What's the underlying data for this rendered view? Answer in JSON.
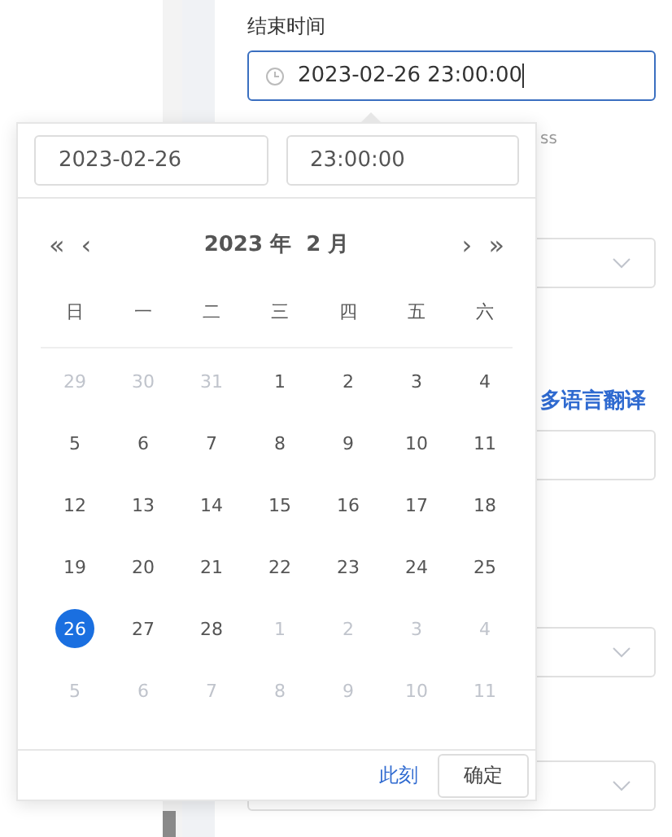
{
  "form": {
    "label": "结束时间",
    "value": "2023-02-26 23:00:00",
    "hint_fragment": "ss",
    "link": "多语言翻译"
  },
  "picker": {
    "date_input": "2023-02-26",
    "time_input": "23:00:00",
    "nav": {
      "prev_year": "«",
      "prev_month": "‹",
      "title": "2023 年  2 月",
      "next_month": "›",
      "next_year": "»"
    },
    "weekdays": [
      "日",
      "一",
      "二",
      "三",
      "四",
      "五",
      "六"
    ],
    "days": [
      {
        "label": "29",
        "muted": true,
        "selected": false
      },
      {
        "label": "30",
        "muted": true,
        "selected": false
      },
      {
        "label": "31",
        "muted": true,
        "selected": false
      },
      {
        "label": "1",
        "muted": false,
        "selected": false
      },
      {
        "label": "2",
        "muted": false,
        "selected": false
      },
      {
        "label": "3",
        "muted": false,
        "selected": false
      },
      {
        "label": "4",
        "muted": false,
        "selected": false
      },
      {
        "label": "5",
        "muted": false,
        "selected": false
      },
      {
        "label": "6",
        "muted": false,
        "selected": false
      },
      {
        "label": "7",
        "muted": false,
        "selected": false
      },
      {
        "label": "8",
        "muted": false,
        "selected": false
      },
      {
        "label": "9",
        "muted": false,
        "selected": false
      },
      {
        "label": "10",
        "muted": false,
        "selected": false
      },
      {
        "label": "11",
        "muted": false,
        "selected": false
      },
      {
        "label": "12",
        "muted": false,
        "selected": false
      },
      {
        "label": "13",
        "muted": false,
        "selected": false
      },
      {
        "label": "14",
        "muted": false,
        "selected": false
      },
      {
        "label": "15",
        "muted": false,
        "selected": false
      },
      {
        "label": "16",
        "muted": false,
        "selected": false
      },
      {
        "label": "17",
        "muted": false,
        "selected": false
      },
      {
        "label": "18",
        "muted": false,
        "selected": false
      },
      {
        "label": "19",
        "muted": false,
        "selected": false
      },
      {
        "label": "20",
        "muted": false,
        "selected": false
      },
      {
        "label": "21",
        "muted": false,
        "selected": false
      },
      {
        "label": "22",
        "muted": false,
        "selected": false
      },
      {
        "label": "23",
        "muted": false,
        "selected": false
      },
      {
        "label": "24",
        "muted": false,
        "selected": false
      },
      {
        "label": "25",
        "muted": false,
        "selected": false
      },
      {
        "label": "26",
        "muted": false,
        "selected": true
      },
      {
        "label": "27",
        "muted": false,
        "selected": false
      },
      {
        "label": "28",
        "muted": false,
        "selected": false
      },
      {
        "label": "1",
        "muted": true,
        "selected": false
      },
      {
        "label": "2",
        "muted": true,
        "selected": false
      },
      {
        "label": "3",
        "muted": true,
        "selected": false
      },
      {
        "label": "4",
        "muted": true,
        "selected": false
      },
      {
        "label": "5",
        "muted": true,
        "selected": false
      },
      {
        "label": "6",
        "muted": true,
        "selected": false
      },
      {
        "label": "7",
        "muted": true,
        "selected": false
      },
      {
        "label": "8",
        "muted": true,
        "selected": false
      },
      {
        "label": "9",
        "muted": true,
        "selected": false
      },
      {
        "label": "10",
        "muted": true,
        "selected": false
      },
      {
        "label": "11",
        "muted": true,
        "selected": false
      }
    ],
    "now_link": "此刻",
    "confirm_button": "确定"
  }
}
